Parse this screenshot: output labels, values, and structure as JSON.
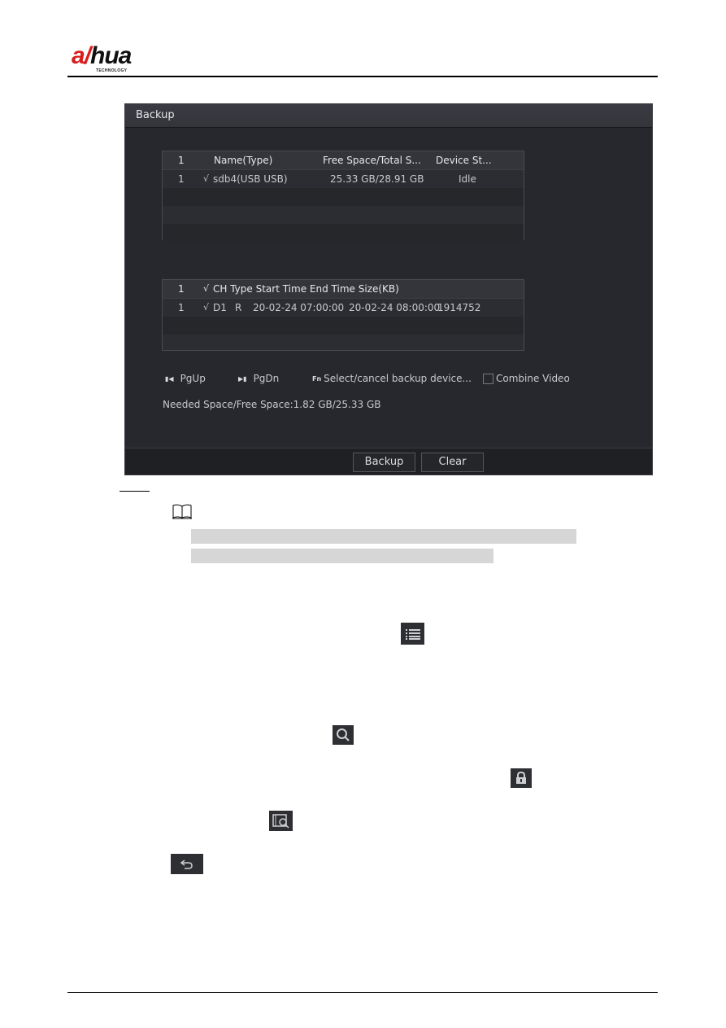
{
  "brand": {
    "logo_main_a": "a",
    "logo_main_slash": "/",
    "logo_main_rest": "hua",
    "logo_sub": "TECHNOLOGY",
    "accent_color": "#d81e1e"
  },
  "window": {
    "title": "Backup",
    "device_table": {
      "headers": [
        "1",
        "Name(Type)",
        "Free Space/Total S...",
        "Device St..."
      ],
      "rows": [
        {
          "index": "1",
          "check": "√",
          "name": "sdb4(USB USB)",
          "space": "25.33 GB/28.91 GB",
          "status": "Idle"
        }
      ]
    },
    "file_table": {
      "header_index": "1",
      "header_check": "√",
      "header_label": "CH Type Start Time End Time Size(KB)",
      "rows": [
        {
          "index": "1",
          "check": "√",
          "ch": "D1",
          "type": "R",
          "start": "20-02-24 07:00:00",
          "end": "20-02-24 08:00:00",
          "size": "1914752"
        }
      ]
    },
    "controls": {
      "pgup_icon": "▮◀",
      "pgup_label": "PgUp",
      "pgdn_icon": "▶▮",
      "pgdn_label": "PgDn",
      "fn_icon": "Fn",
      "fn_label": "Select/cancel backup device...",
      "combine_label": "Combine Video",
      "combine_checked": false
    },
    "needed_space": "Needed Space/Free Space:1.82 GB/25.33 GB",
    "buttons": {
      "backup": "Backup",
      "clear": "Clear"
    }
  },
  "inline_icons": [
    "list-icon",
    "search-icon",
    "lock-icon",
    "smart-search-icon",
    "back-icon"
  ]
}
